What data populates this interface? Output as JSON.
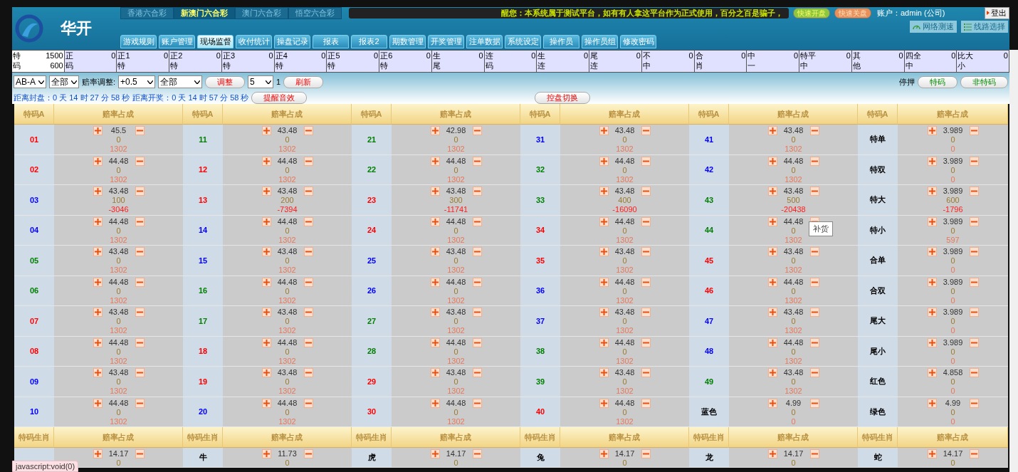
{
  "brand": "华开",
  "lottery_tabs": [
    {
      "label": "香港六合彩",
      "selected": false
    },
    {
      "label": "新澳门六合彩",
      "selected": true
    },
    {
      "label": "澳门六合彩",
      "selected": false
    },
    {
      "label": "悟空六合彩",
      "selected": false
    }
  ],
  "notice": "醒您：本系统属于测试平台，如有有人拿这平台作为正式使用，百分之百是骗子，",
  "quick_buttons": [
    {
      "label": "快速开盘",
      "kind": "open"
    },
    {
      "label": "快速关盘",
      "kind": "close"
    }
  ],
  "account": "账户：admin (公司)",
  "logout": "登出",
  "tools": [
    {
      "label": "网络测速",
      "kind": "speed"
    },
    {
      "label": "线路选择",
      "kind": "route"
    }
  ],
  "nav": [
    {
      "label": "游戏规则",
      "selected": false
    },
    {
      "label": "账户管理",
      "selected": false
    },
    {
      "label": "现场监督",
      "selected": true
    },
    {
      "label": "收付统计",
      "selected": false
    },
    {
      "label": "操盘记录",
      "selected": false
    },
    {
      "label": "报表",
      "selected": false
    },
    {
      "label": "报表2",
      "selected": false
    },
    {
      "label": "期数管理",
      "selected": false
    },
    {
      "label": "开奖管理",
      "selected": false
    },
    {
      "label": "注单数据",
      "selected": false
    },
    {
      "label": "系统设定",
      "selected": false
    },
    {
      "label": "操作员",
      "selected": false
    },
    {
      "label": "操作员组",
      "selected": false
    },
    {
      "label": "修改密码",
      "selected": false
    }
  ],
  "summary": [
    {
      "top": "特",
      "bottom": "码",
      "counts": [
        "1500",
        "600"
      ],
      "selected": true
    },
    {
      "top": "正",
      "bottom": "码",
      "counts": [
        "0"
      ],
      "selected": false
    },
    {
      "top": "正1",
      "bottom": "特",
      "counts": [
        "0"
      ],
      "selected": false
    },
    {
      "top": "正2",
      "bottom": "特",
      "counts": [
        "0"
      ],
      "selected": false
    },
    {
      "top": "正3",
      "bottom": "特",
      "counts": [
        "0"
      ],
      "selected": false
    },
    {
      "top": "正4",
      "bottom": "特",
      "counts": [
        "0"
      ],
      "selected": false
    },
    {
      "top": "正5",
      "bottom": "特",
      "counts": [
        "0"
      ],
      "selected": false
    },
    {
      "top": "正6",
      "bottom": "特",
      "counts": [
        "0"
      ],
      "selected": false
    },
    {
      "top": "生",
      "bottom": "尾",
      "counts": [
        "0"
      ],
      "selected": false
    },
    {
      "top": "连",
      "bottom": "码",
      "counts": [
        "0"
      ],
      "selected": false
    },
    {
      "top": "生",
      "bottom": "连",
      "counts": [
        "0"
      ],
      "selected": false
    },
    {
      "top": "尾",
      "bottom": "连",
      "counts": [
        "0"
      ],
      "selected": false
    },
    {
      "top": "不",
      "bottom": "中",
      "counts": [
        "0"
      ],
      "selected": false
    },
    {
      "top": "合",
      "bottom": "肖",
      "counts": [
        "0"
      ],
      "selected": false
    },
    {
      "top": "中",
      "bottom": "一",
      "counts": [
        "0"
      ],
      "selected": false
    },
    {
      "top": "特平",
      "bottom": "中",
      "counts": [
        "0"
      ],
      "selected": false
    },
    {
      "top": "其",
      "bottom": "他",
      "counts": [
        "0"
      ],
      "selected": false
    },
    {
      "top": "四全",
      "bottom": "中",
      "counts": [
        "0"
      ],
      "selected": false
    },
    {
      "top": "比大",
      "bottom": "小",
      "counts": [
        "0"
      ],
      "selected": false
    }
  ],
  "controls": {
    "type_select": "AB-A",
    "scope_select": "全部",
    "odds_label": "赔率调整:",
    "step_select": "+0.5",
    "range_select": "全部",
    "adjust_button": "调整",
    "refresh_select": "5",
    "refresh_unit": "1",
    "refresh_button": "刷新",
    "stop_label": "停押",
    "stop_buttons": [
      "特码",
      "非特码"
    ]
  },
  "countdown": {
    "close": "距离封盘：0 天 14 时 27 分 58 秒",
    "draw": "距离开奖：0 天 14 时 57 分 58 秒",
    "sound_button": "提醒音效",
    "switch_button": "控盘切换"
  },
  "table": {
    "header": [
      "特码A",
      "赔率占成",
      "特码A",
      "赔率占成",
      "特码A",
      "赔率占成",
      "特码A",
      "赔率占成",
      "特码A",
      "赔率占成",
      "特码A",
      "赔率占成"
    ],
    "rows": [
      [
        {
          "label": "01",
          "color": "#ff0000",
          "odds": "45.5",
          "amount": "0",
          "profit": "1302",
          "loss": false
        },
        {
          "label": "11",
          "color": "#008000",
          "odds": "43.48",
          "amount": "0",
          "profit": "1302",
          "loss": false
        },
        {
          "label": "21",
          "color": "#008000",
          "odds": "42.98",
          "amount": "0",
          "profit": "1302",
          "loss": false
        },
        {
          "label": "31",
          "color": "#0000ff",
          "odds": "43.48",
          "amount": "0",
          "profit": "1302",
          "loss": false
        },
        {
          "label": "41",
          "color": "#0000ff",
          "odds": "43.48",
          "amount": "0",
          "profit": "1302",
          "loss": false
        },
        {
          "label": "特单",
          "color": "#000000",
          "odds": "3.989",
          "amount": "0",
          "profit": "0",
          "loss": false
        }
      ],
      [
        {
          "label": "02",
          "color": "#ff0000",
          "odds": "44.48",
          "amount": "0",
          "profit": "1302",
          "loss": false
        },
        {
          "label": "12",
          "color": "#ff0000",
          "odds": "44.48",
          "amount": "0",
          "profit": "1302",
          "loss": false
        },
        {
          "label": "22",
          "color": "#008000",
          "odds": "44.48",
          "amount": "0",
          "profit": "1302",
          "loss": false
        },
        {
          "label": "32",
          "color": "#008000",
          "odds": "44.48",
          "amount": "0",
          "profit": "1302",
          "loss": false
        },
        {
          "label": "42",
          "color": "#0000ff",
          "odds": "44.48",
          "amount": "0",
          "profit": "1302",
          "loss": false
        },
        {
          "label": "特双",
          "color": "#000000",
          "odds": "3.989",
          "amount": "0",
          "profit": "0",
          "loss": false
        }
      ],
      [
        {
          "label": "03",
          "color": "#0000ff",
          "odds": "43.48",
          "amount": "100",
          "profit": "-3046",
          "loss": true
        },
        {
          "label": "13",
          "color": "#ff0000",
          "odds": "43.48",
          "amount": "200",
          "profit": "-7394",
          "loss": true
        },
        {
          "label": "23",
          "color": "#ff0000",
          "odds": "43.48",
          "amount": "300",
          "profit": "-11741",
          "loss": true
        },
        {
          "label": "33",
          "color": "#008000",
          "odds": "43.48",
          "amount": "400",
          "profit": "-16090",
          "loss": true
        },
        {
          "label": "43",
          "color": "#008000",
          "odds": "43.48",
          "amount": "500",
          "profit": "-20438",
          "loss": true
        },
        {
          "label": "特大",
          "color": "#000000",
          "odds": "3.989",
          "amount": "600",
          "profit": "-1796",
          "loss": true
        }
      ],
      [
        {
          "label": "04",
          "color": "#0000ff",
          "odds": "44.48",
          "amount": "0",
          "profit": "1302",
          "loss": false
        },
        {
          "label": "14",
          "color": "#0000ff",
          "odds": "44.48",
          "amount": "0",
          "profit": "1302",
          "loss": false
        },
        {
          "label": "24",
          "color": "#ff0000",
          "odds": "44.48",
          "amount": "0",
          "profit": "1302",
          "loss": false
        },
        {
          "label": "34",
          "color": "#ff0000",
          "odds": "44.48",
          "amount": "0",
          "profit": "1302",
          "loss": false
        },
        {
          "label": "44",
          "color": "#008000",
          "odds": "44.48",
          "amount": "0",
          "profit": "1302",
          "loss": false
        },
        {
          "label": "特小",
          "color": "#000000",
          "odds": "3.989",
          "amount": "0",
          "profit": "597",
          "loss": false
        }
      ],
      [
        {
          "label": "05",
          "color": "#008000",
          "odds": "43.48",
          "amount": "0",
          "profit": "1302",
          "loss": false
        },
        {
          "label": "15",
          "color": "#0000ff",
          "odds": "43.48",
          "amount": "0",
          "profit": "1302",
          "loss": false
        },
        {
          "label": "25",
          "color": "#0000ff",
          "odds": "43.48",
          "amount": "0",
          "profit": "1302",
          "loss": false
        },
        {
          "label": "35",
          "color": "#ff0000",
          "odds": "43.48",
          "amount": "0",
          "profit": "1302",
          "loss": false
        },
        {
          "label": "45",
          "color": "#ff0000",
          "odds": "43.48",
          "amount": "0",
          "profit": "1302",
          "loss": false
        },
        {
          "label": "合单",
          "color": "#000000",
          "odds": "3.989",
          "amount": "0",
          "profit": "0",
          "loss": false
        }
      ],
      [
        {
          "label": "06",
          "color": "#008000",
          "odds": "44.48",
          "amount": "0",
          "profit": "1302",
          "loss": false
        },
        {
          "label": "16",
          "color": "#008000",
          "odds": "44.48",
          "amount": "0",
          "profit": "1302",
          "loss": false
        },
        {
          "label": "26",
          "color": "#0000ff",
          "odds": "44.48",
          "amount": "0",
          "profit": "1302",
          "loss": false
        },
        {
          "label": "36",
          "color": "#0000ff",
          "odds": "44.48",
          "amount": "0",
          "profit": "1302",
          "loss": false
        },
        {
          "label": "46",
          "color": "#ff0000",
          "odds": "44.48",
          "amount": "0",
          "profit": "1302",
          "loss": false
        },
        {
          "label": "合双",
          "color": "#000000",
          "odds": "3.989",
          "amount": "0",
          "profit": "0",
          "loss": false
        }
      ],
      [
        {
          "label": "07",
          "color": "#ff0000",
          "odds": "43.48",
          "amount": "0",
          "profit": "1302",
          "loss": false
        },
        {
          "label": "17",
          "color": "#008000",
          "odds": "43.48",
          "amount": "0",
          "profit": "1302",
          "loss": false
        },
        {
          "label": "27",
          "color": "#008000",
          "odds": "43.48",
          "amount": "0",
          "profit": "1302",
          "loss": false
        },
        {
          "label": "37",
          "color": "#0000ff",
          "odds": "43.48",
          "amount": "0",
          "profit": "1302",
          "loss": false
        },
        {
          "label": "47",
          "color": "#0000ff",
          "odds": "43.48",
          "amount": "0",
          "profit": "1302",
          "loss": false
        },
        {
          "label": "尾大",
          "color": "#000000",
          "odds": "3.989",
          "amount": "0",
          "profit": "0",
          "loss": false
        }
      ],
      [
        {
          "label": "08",
          "color": "#ff0000",
          "odds": "44.48",
          "amount": "0",
          "profit": "1302",
          "loss": false
        },
        {
          "label": "18",
          "color": "#ff0000",
          "odds": "44.48",
          "amount": "0",
          "profit": "1302",
          "loss": false
        },
        {
          "label": "28",
          "color": "#008000",
          "odds": "44.48",
          "amount": "0",
          "profit": "1302",
          "loss": false
        },
        {
          "label": "38",
          "color": "#008000",
          "odds": "44.48",
          "amount": "0",
          "profit": "1302",
          "loss": false
        },
        {
          "label": "48",
          "color": "#0000ff",
          "odds": "44.48",
          "amount": "0",
          "profit": "1302",
          "loss": false
        },
        {
          "label": "尾小",
          "color": "#000000",
          "odds": "3.989",
          "amount": "0",
          "profit": "0",
          "loss": false
        }
      ],
      [
        {
          "label": "09",
          "color": "#0000ff",
          "odds": "43.48",
          "amount": "0",
          "profit": "1302",
          "loss": false
        },
        {
          "label": "19",
          "color": "#ff0000",
          "odds": "43.48",
          "amount": "0",
          "profit": "1302",
          "loss": false
        },
        {
          "label": "29",
          "color": "#ff0000",
          "odds": "43.48",
          "amount": "0",
          "profit": "1302",
          "loss": false
        },
        {
          "label": "39",
          "color": "#008000",
          "odds": "43.48",
          "amount": "0",
          "profit": "1302",
          "loss": false
        },
        {
          "label": "49",
          "color": "#008000",
          "odds": "43.48",
          "amount": "0",
          "profit": "1302",
          "loss": false
        },
        {
          "label": "红色",
          "color": "#000000",
          "odds": "4.858",
          "amount": "0",
          "profit": "0",
          "loss": false
        }
      ],
      [
        {
          "label": "10",
          "color": "#0000ff",
          "odds": "44.48",
          "amount": "0",
          "profit": "1302",
          "loss": false
        },
        {
          "label": "20",
          "color": "#0000ff",
          "odds": "44.48",
          "amount": "0",
          "profit": "1302",
          "loss": false
        },
        {
          "label": "30",
          "color": "#ff0000",
          "odds": "44.48",
          "amount": "0",
          "profit": "1302",
          "loss": false
        },
        {
          "label": "40",
          "color": "#ff0000",
          "odds": "44.48",
          "amount": "0",
          "profit": "1302",
          "loss": false
        },
        {
          "label": "蓝色",
          "color": "#000000",
          "odds": "4.99",
          "amount": "0",
          "profit": "0",
          "loss": false
        },
        {
          "label": "绿色",
          "color": "#000000",
          "odds": "4.99",
          "amount": "0",
          "profit": "0",
          "loss": false
        }
      ]
    ],
    "tooltip": "补货"
  },
  "zodiac_table": {
    "header": [
      "特码生肖",
      "赔率占成",
      "特码生肖",
      "赔率占成",
      "特码生肖",
      "赔率占成",
      "特码生肖",
      "赔率占成",
      "特码生肖",
      "赔率占成",
      "特码生肖",
      "赔率占成"
    ],
    "rows": [
      [
        {
          "odds": "14.17",
          "amount": "0"
        },
        {
          "label": "牛",
          "odds": "11.73",
          "amount": "0"
        },
        {
          "label": "虎",
          "odds": "14.17",
          "amount": "0"
        },
        {
          "label": "兔",
          "odds": "14.17",
          "amount": "0"
        },
        {
          "label": "龙",
          "odds": "14.17",
          "amount": "0"
        },
        {
          "label": "蛇",
          "odds": "14.17",
          "amount": "0"
        }
      ]
    ]
  },
  "status_bar": "javascript:void(0)"
}
